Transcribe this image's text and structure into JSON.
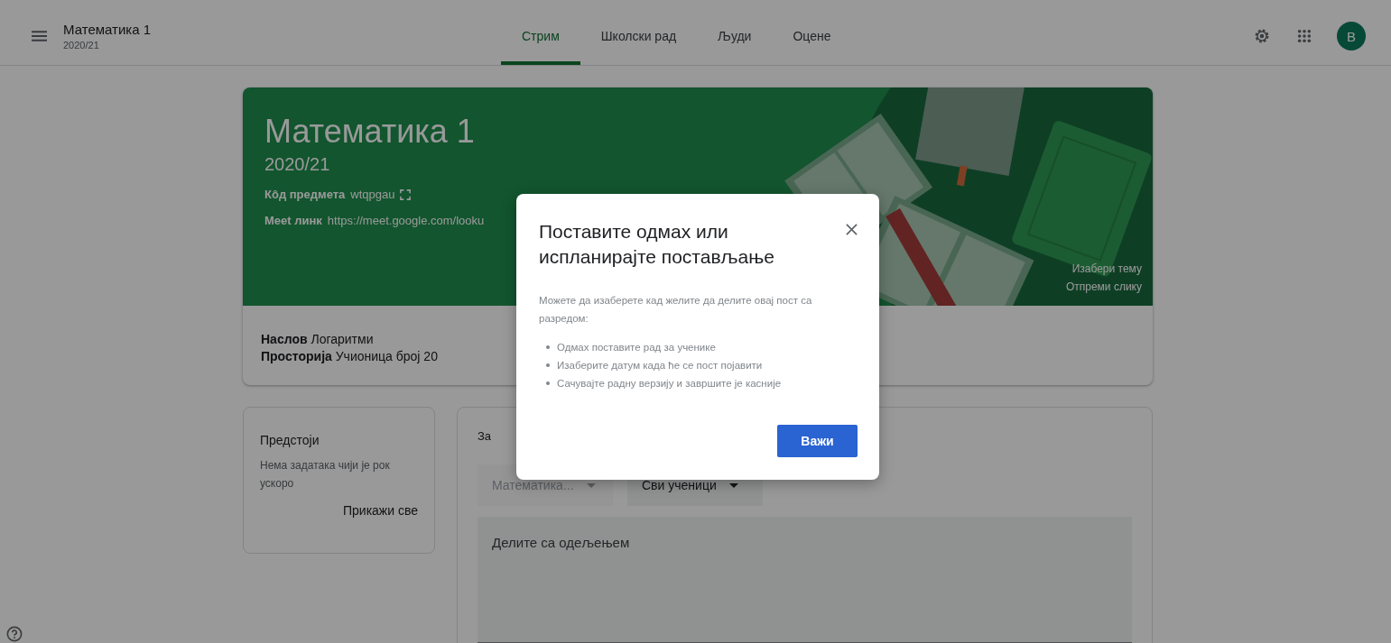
{
  "header": {
    "title": "Математика 1",
    "subtitle": "2020/21",
    "avatar": "B"
  },
  "tabs": [
    {
      "label": "Стрим",
      "selected": true
    },
    {
      "label": "Школски рад",
      "selected": false
    },
    {
      "label": "Људи",
      "selected": false
    },
    {
      "label": "Оцене",
      "selected": false
    }
  ],
  "banner": {
    "title": "Математика 1",
    "subtitle": "2020/21",
    "code_label": "Кôд предмета",
    "code": "wtqpgau",
    "meet_label": "Meet линк",
    "meet_link": "https://meet.google.com/looku",
    "links": [
      "Изабери тему",
      "Отпреми слику"
    ]
  },
  "details": [
    {
      "label": "Наслов",
      "value": "Логаритми"
    },
    {
      "label": "Просторија",
      "value": "Учионица број 20"
    }
  ],
  "upcoming": {
    "title": "Предстоји",
    "text": "Нема задатака чији је рок ускоро",
    "link": "Прикажи све"
  },
  "composer": {
    "for_label": "За",
    "dropdowns": [
      {
        "label": "Математика...",
        "disabled": true
      },
      {
        "label": "Сви ученици",
        "disabled": false
      }
    ],
    "placeholder": "Делите са одељењем"
  },
  "dialog": {
    "title": "Поставите одмах или испланирајте постављање",
    "text": "Можете да изаберете кад желите да делите овај пост са разредом:",
    "bullets": [
      "Одмах поставите рад за ученике",
      "Изаберите датум када ће се пост појавити",
      "Сачувајте радну верзију и завршите је касније"
    ],
    "button": "Важи"
  }
}
